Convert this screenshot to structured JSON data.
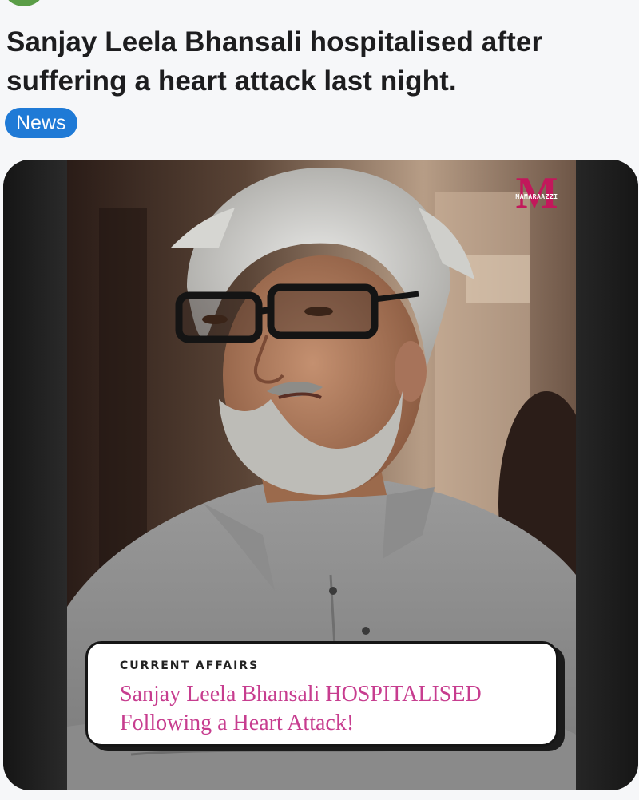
{
  "post": {
    "headline": "Sanjay Leela Bhansali hospitalised after suffering a heart attack last night.",
    "tag": "News"
  },
  "media": {
    "brand_logo_letter": "M",
    "brand_logo_text": "MAMARAAZZI",
    "banner_kicker": "CURRENT AFFAIRS",
    "banner_title": "Sanjay Leela Bhansali HOSPITALISED\nFollowing a Heart Attack!"
  },
  "colors": {
    "tag_background": "#1f7ad6",
    "banner_title": "#c73d8f",
    "brand_logo": "#c2185b"
  }
}
